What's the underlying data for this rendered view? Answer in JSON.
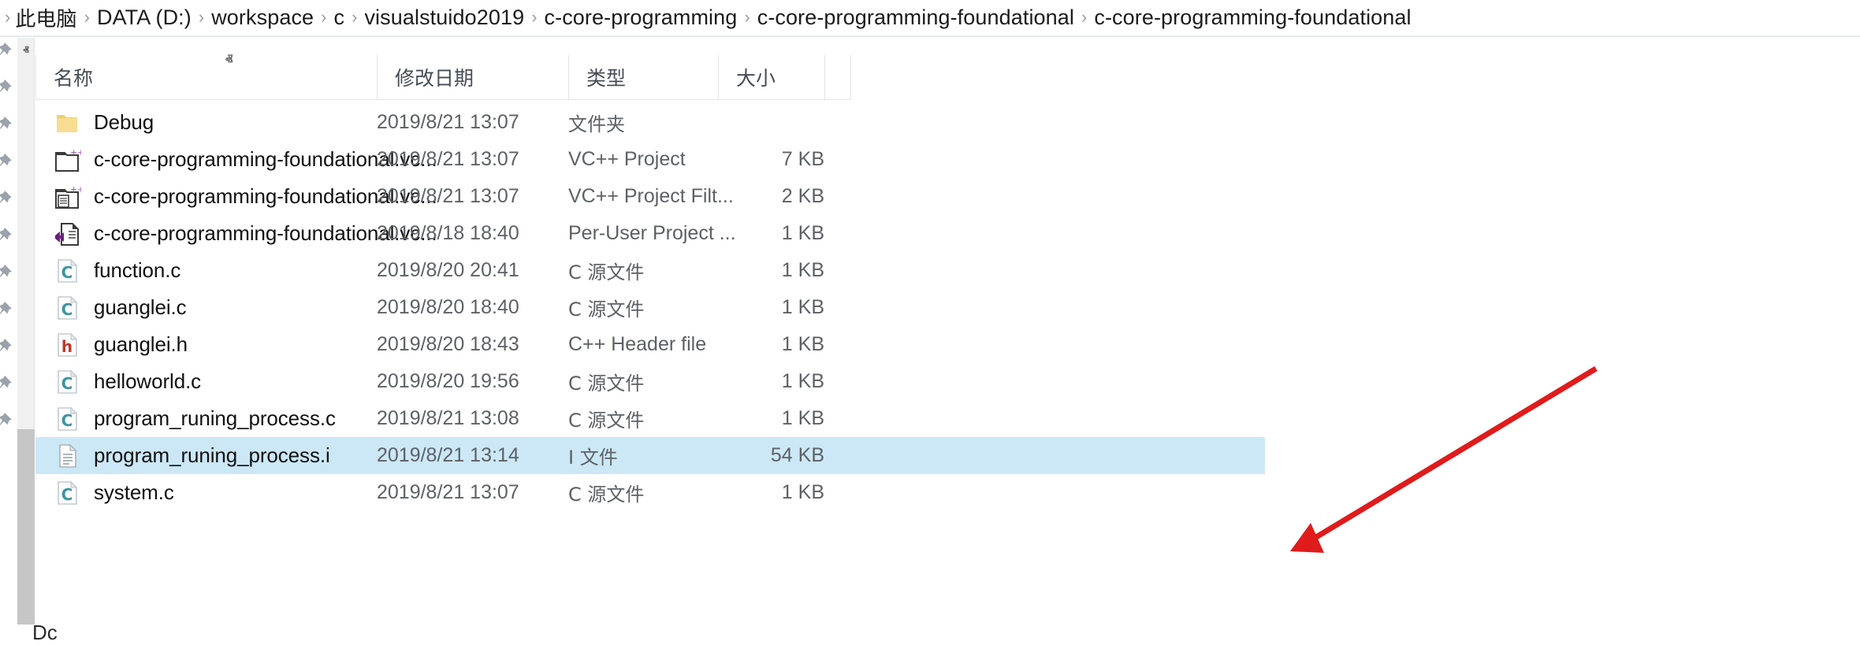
{
  "breadcrumb": {
    "separator": "›",
    "items": [
      {
        "label": "此电脑",
        "cjk": true
      },
      {
        "label": "DATA (D:)",
        "cjk": false
      },
      {
        "label": "workspace",
        "cjk": false
      },
      {
        "label": "c",
        "cjk": false
      },
      {
        "label": "visualstuido2019",
        "cjk": false
      },
      {
        "label": "c-core-programming",
        "cjk": false
      },
      {
        "label": "c-core-programming-foundational",
        "cjk": false
      },
      {
        "label": "c-core-programming-foundational",
        "cjk": false
      }
    ]
  },
  "columns": {
    "name": "名称",
    "date": "修改日期",
    "type": "类型",
    "size": "大小",
    "sort_caret": "ⱏ",
    "sort_column": "名称",
    "sort_direction": "ascending"
  },
  "scrollbar": {
    "up_arrow": "ⱏ"
  },
  "bottom_glyph": "Dc",
  "colors": {
    "selection": "#cce8f7",
    "annotation_arrow": "#e01b1b",
    "folder_icon": "#f5d77c",
    "c_file_glyph": "#3f93a0",
    "h_file_glyph": "#c0392b",
    "vs_logo": "#68217a",
    "header_text": "#444c56",
    "meta_text": "#5d6165"
  },
  "files": [
    {
      "name": "Debug",
      "icon": "folder-icon",
      "date": "2019/8/21 13:07",
      "type": "文件夹",
      "type_cjk": true,
      "size": "",
      "selected": false
    },
    {
      "name": "c-core-programming-foundational.vc...",
      "icon": "vcxproj-icon",
      "date": "2019/8/21 13:07",
      "type": "VC++ Project",
      "type_cjk": false,
      "size": "7 KB",
      "selected": false
    },
    {
      "name": "c-core-programming-foundational.vc...",
      "icon": "vcxproj-filters-icon",
      "date": "2019/8/21 13:07",
      "type": "VC++ Project Filt...",
      "type_cjk": false,
      "size": "2 KB",
      "selected": false
    },
    {
      "name": "c-core-programming-foundational.vc...",
      "icon": "vcxproj-user-icon",
      "date": "2019/8/18 18:40",
      "type": "Per-User Project ...",
      "type_cjk": false,
      "size": "1 KB",
      "selected": false
    },
    {
      "name": "function.c",
      "icon": "c-source-icon",
      "date": "2019/8/20 20:41",
      "type": "C 源文件",
      "type_cjk": true,
      "size": "1 KB",
      "selected": false
    },
    {
      "name": "guanglei.c",
      "icon": "c-source-icon",
      "date": "2019/8/20 18:40",
      "type": "C 源文件",
      "type_cjk": true,
      "size": "1 KB",
      "selected": false
    },
    {
      "name": "guanglei.h",
      "icon": "h-header-icon",
      "date": "2019/8/20 18:43",
      "type": "C++ Header file",
      "type_cjk": false,
      "size": "1 KB",
      "selected": false
    },
    {
      "name": "helloworld.c",
      "icon": "c-source-icon",
      "date": "2019/8/20 19:56",
      "type": "C 源文件",
      "type_cjk": true,
      "size": "1 KB",
      "selected": false
    },
    {
      "name": "program_runing_process.c",
      "icon": "c-source-icon",
      "date": "2019/8/21 13:08",
      "type": "C 源文件",
      "type_cjk": true,
      "size": "1 KB",
      "selected": false
    },
    {
      "name": "program_runing_process.i",
      "icon": "text-file-icon",
      "date": "2019/8/21 13:14",
      "type": "I 文件",
      "type_cjk": true,
      "size": "54 KB",
      "selected": true
    },
    {
      "name": "system.c",
      "icon": "c-source-icon",
      "date": "2019/8/21 13:07",
      "type": "C 源文件",
      "type_cjk": true,
      "size": "1 KB",
      "selected": false
    }
  ]
}
